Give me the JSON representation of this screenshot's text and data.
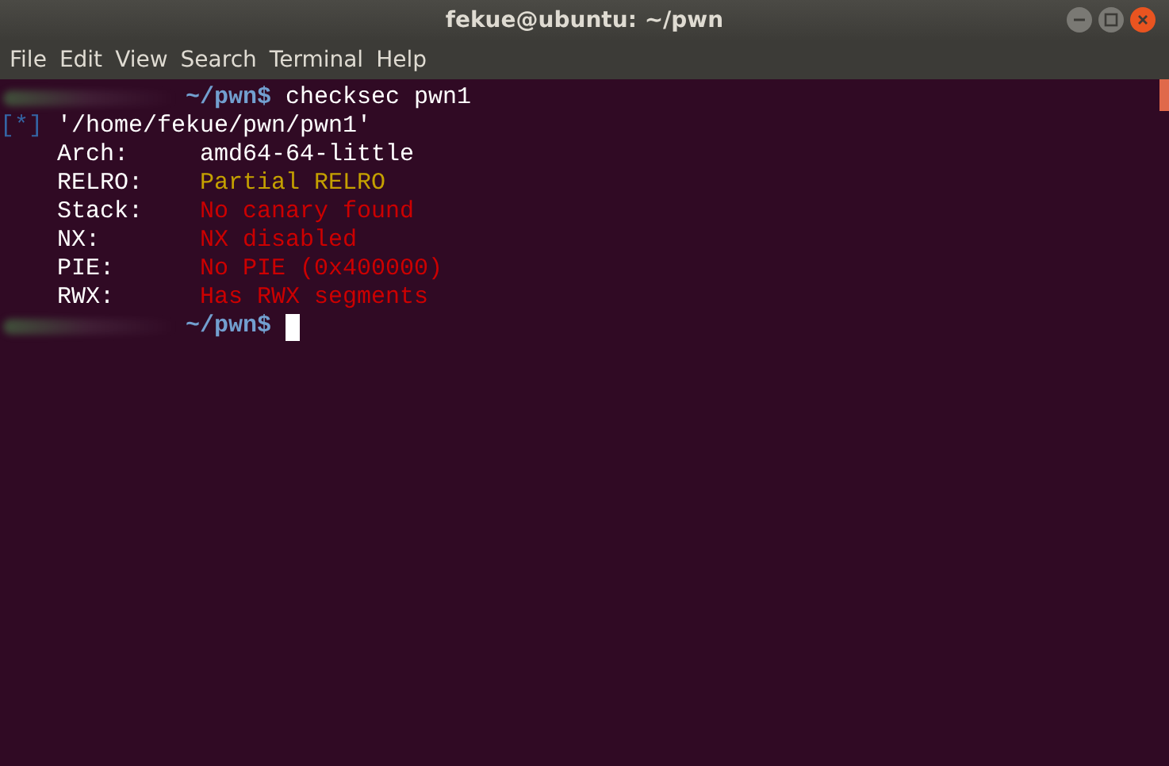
{
  "window": {
    "title": "fekue@ubuntu: ~/pwn"
  },
  "menu": [
    "File",
    "Edit",
    "View",
    "Search",
    "Terminal",
    "Help"
  ],
  "terminal": {
    "lines": [
      {
        "kind": "prompt",
        "segments": [
          {
            "text": "~/pwn$",
            "color": "#729fcf"
          },
          {
            "text": " checksec pwn1",
            "color": "#ffffff"
          }
        ]
      },
      {
        "kind": "output",
        "segments": [
          {
            "text": "[*]",
            "color": "#3465a4"
          },
          {
            "text": " '/home/fekue/pwn/pwn1'",
            "color": "#ffffff"
          }
        ]
      },
      {
        "kind": "output",
        "segments": [
          {
            "text": "    Arch:     ",
            "color": "#ffffff"
          },
          {
            "text": "amd64-64-little",
            "color": "#ffffff"
          }
        ]
      },
      {
        "kind": "output",
        "segments": [
          {
            "text": "    RELRO:    ",
            "color": "#ffffff"
          },
          {
            "text": "Partial RELRO",
            "color": "#c4a000"
          }
        ]
      },
      {
        "kind": "output",
        "segments": [
          {
            "text": "    Stack:    ",
            "color": "#ffffff"
          },
          {
            "text": "No canary found",
            "color": "#cc0000"
          }
        ]
      },
      {
        "kind": "output",
        "segments": [
          {
            "text": "    NX:       ",
            "color": "#ffffff"
          },
          {
            "text": "NX disabled",
            "color": "#cc0000"
          }
        ]
      },
      {
        "kind": "output",
        "segments": [
          {
            "text": "    PIE:      ",
            "color": "#ffffff"
          },
          {
            "text": "No PIE (0x400000)",
            "color": "#cc0000"
          }
        ]
      },
      {
        "kind": "output",
        "segments": [
          {
            "text": "    RWX:      ",
            "color": "#ffffff"
          },
          {
            "text": "Has RWX segments",
            "color": "#cc0000"
          }
        ]
      },
      {
        "kind": "prompt",
        "cursor": true,
        "segments": [
          {
            "text": "~/pwn$",
            "color": "#729fcf"
          }
        ]
      }
    ]
  }
}
